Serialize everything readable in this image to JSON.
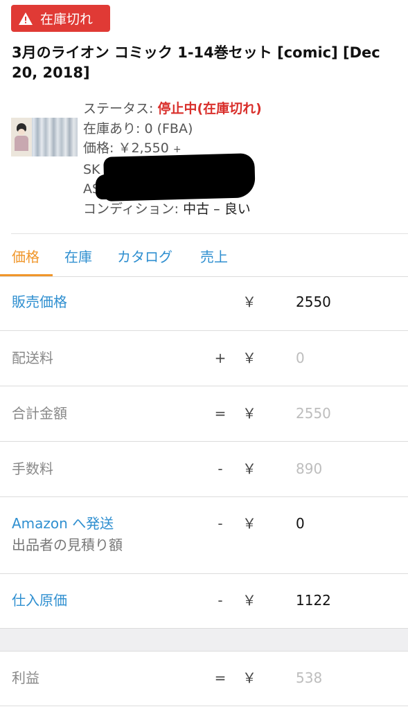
{
  "badge": {
    "label": "在庫切れ",
    "icon": "warning-triangle-icon",
    "color": "#e03a35"
  },
  "product": {
    "title": "3月のライオン コミック 1-14巻セット [comic] [Dec 20, 2018]",
    "status_label": "ステータス: ",
    "status_value": "停止中(在庫切れ)",
    "stock_label": "在庫あり: ",
    "stock_value": "0 (FBA)",
    "price_label": "価格: ",
    "price_value": "￥2,550",
    "price_plus": "+",
    "sku_label": "SK",
    "asin_label": "AS",
    "condition_label": "コンディション: ",
    "condition_value": "中古 – 良い"
  },
  "tabs": [
    {
      "label": "価格",
      "active": true
    },
    {
      "label": "在庫",
      "active": false
    },
    {
      "label": "カタログ",
      "active": false
    },
    {
      "label": "売上",
      "active": false
    }
  ],
  "fields": {
    "sale_price": {
      "label": "販売価格",
      "op": "",
      "currency": "￥",
      "value": "2550"
    },
    "shipping": {
      "label": "配送料",
      "op": "+",
      "currency": "￥",
      "value": "0"
    },
    "total": {
      "label": "合計金額",
      "op": "=",
      "currency": "￥",
      "value": "2550"
    },
    "fee": {
      "label": "手数料",
      "op": "-",
      "currency": "￥",
      "value": "890"
    },
    "to_amazon": {
      "label": "Amazon へ発送",
      "sublabel": "出品者の見積り額",
      "op": "-",
      "currency": "￥",
      "value": "0"
    },
    "cost": {
      "label": "仕入原価",
      "op": "-",
      "currency": "￥",
      "value": "1122"
    },
    "profit": {
      "label": "利益",
      "op": "=",
      "currency": "￥",
      "value": "538"
    }
  },
  "colors": {
    "accent_orange": "#f0962a",
    "link_blue": "#2f8fd0",
    "status_red": "#d9302c"
  }
}
